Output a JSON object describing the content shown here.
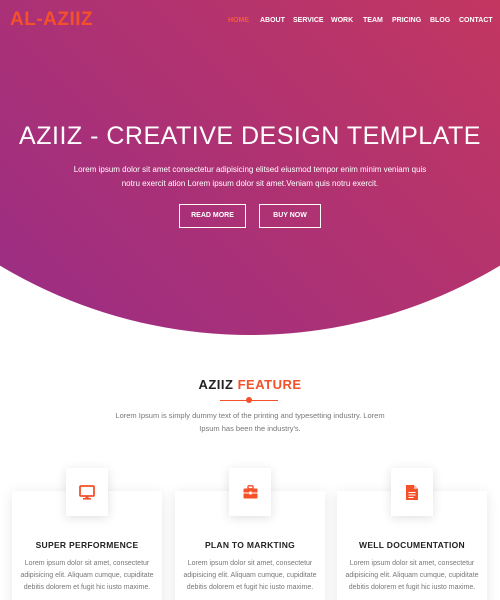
{
  "brand": {
    "logo": "AL-AZIIZ"
  },
  "nav": {
    "items": [
      {
        "label": "HOME"
      },
      {
        "label": "ABOUT"
      },
      {
        "label": "SERVICE"
      },
      {
        "label": "WORK"
      },
      {
        "label": "TEAM"
      },
      {
        "label": "PRICING"
      },
      {
        "label": "BLOG"
      },
      {
        "label": "CONTACT"
      }
    ],
    "active_color": "#f65a3a"
  },
  "hero": {
    "title": "AZIIZ - CREATIVE DESIGN TEMPLATE",
    "text_line1": "Lorem ipsum dolor sit amet consectetur adipisicing elitsed eiusmod tempor enim minim veniam quis",
    "text_line2": "notru exercit ation Lorem ipsum dolor sit amet.Veniam quis notru exercit.",
    "read_more": "READ MORE",
    "buy_now": "BUY NOW",
    "gradient": [
      "#ea4a33",
      "#c4375f",
      "#8e2a90"
    ]
  },
  "feature": {
    "title_main": "AZIIZ",
    "title_accent": "FEATURE",
    "text_line1": "Lorem Ipsum is simply dummy text of the printing and typesetting industry. Lorem",
    "text_line2": "Ipsum has been the industry's.",
    "accent_color": "#f4512a",
    "cards": [
      {
        "icon": "monitor-icon",
        "title": "SUPER PERFORMENCE",
        "line1": "Lorem ipsum dolor sit amet, consectetur",
        "line2": "adipisicing elit. Aliquam cumque, cupiditate",
        "line3": "debitis dolorem et fugit hic iusto maxime."
      },
      {
        "icon": "briefcase-icon",
        "title": "PLAN TO MARKTING",
        "line1": "Lorem ipsum dolor sit amet, consectetur",
        "line2": "adipisicing elit. Aliquam cumque, cupiditate",
        "line3": "debitis dolorem et fugit hic iusto maxime."
      },
      {
        "icon": "document-icon",
        "title": "WELL DOCUMENTATION",
        "line1": "Lorem ipsum dolor sit amet, consectetur",
        "line2": "adipisicing elit. Aliquam cumque, cupiditate",
        "line3": "debitis dolorem et fugit hic iusto maxime."
      }
    ]
  }
}
